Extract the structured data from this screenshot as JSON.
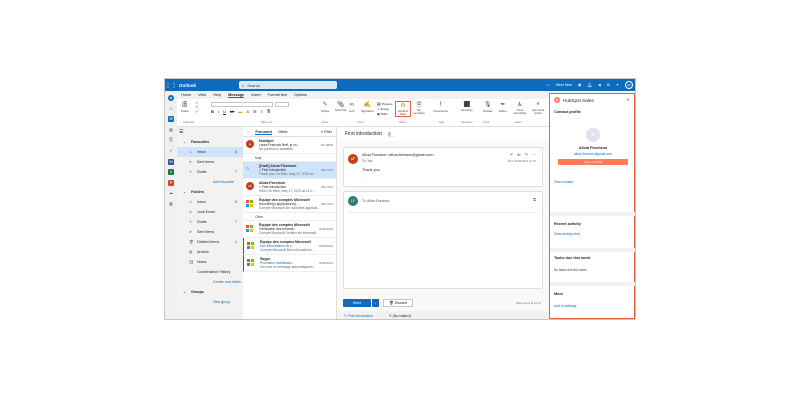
{
  "app": {
    "name": "Outlook",
    "search_placeholder": "Search",
    "meet_now": "Meet Now",
    "avatar_initials": "AF",
    "accent": "#0f6cbd",
    "hubspot_accent": "#ff7a59"
  },
  "rail_icons": [
    "user-avatar",
    "people",
    "mail",
    "calendar",
    "files",
    "to-do",
    "word",
    "excel",
    "powerpoint",
    "onedrive",
    "more-apps"
  ],
  "tabs": [
    "Home",
    "View",
    "Help",
    "Message",
    "Insert",
    "Format text",
    "Options"
  ],
  "active_tab": "Message",
  "ribbon": {
    "paste": "Paste",
    "groups": [
      "Clipboard",
      "Basic text",
      "Styles",
      "Insert",
      "Add-in",
      "Tags",
      "Sensitivity",
      "Voice",
      "Editor"
    ],
    "buttons": {
      "styles": "Styles",
      "attach": "Attach file",
      "link": "Link",
      "signature": "Signature",
      "pictures": "Pictures",
      "emoji": "Emoji",
      "table": "Table",
      "hubspot": "HubSpot Sales",
      "my_templates": "My templates",
      "importance": "Importance",
      "sensitivity": "Sensitivity",
      "dictate": "Dictate",
      "editor": "Editor",
      "check_access": "Check accessibility",
      "auto_format": "Auto format options"
    }
  },
  "folders": {
    "favorites_label": "Favourites",
    "favorites": [
      {
        "name": "Inbox",
        "count": "6",
        "selected": true
      },
      {
        "name": "Sent Items",
        "count": ""
      },
      {
        "name": "Drafts",
        "count": "7"
      }
    ],
    "add_favourite": "Add favourite",
    "folders_label": "Folders",
    "folders": [
      {
        "name": "Inbox",
        "count": "6"
      },
      {
        "name": "Junk Email",
        "count": ""
      },
      {
        "name": "Drafts",
        "count": "7"
      },
      {
        "name": "Sent Items",
        "count": ""
      },
      {
        "name": "Deleted Items",
        "count": "1"
      },
      {
        "name": "Archive",
        "count": ""
      },
      {
        "name": "Notes",
        "count": ""
      },
      {
        "name": "Conversation History",
        "count": ""
      }
    ],
    "create_new": "Create new folder",
    "groups_label": "Groups",
    "new_group": "New group"
  },
  "message_list": {
    "focused": "Focused",
    "other": "Other",
    "filter": "Filter",
    "messages": [
      {
        "avatar": "H",
        "avatar_color": "#c43e1c",
        "from": "HubSpot",
        "subject": "Laura Francois Neff, je vo...",
        "date": "Thu 08/06",
        "preview": "No preview is available."
      },
      {
        "separator": "May"
      },
      {
        "from": "[Draft] Alicia Floreison",
        "subject": "> First introduction",
        "date": "Wed 5/31",
        "preview": "Thank you On Wed, May 17, 2023 at...",
        "selected": true
      },
      {
        "avatar": "AF",
        "avatar_color": "#c43e1c",
        "from": "Alicia Floreison",
        "subject": "> First introduction",
        "date": "Wed 5/31",
        "preview": "Hello On Wed, May 17, 2023 at 11:0..."
      },
      {
        "ms": true,
        "from": "Équipe des comptes Microsoft",
        "subject": "Nouvelle(s) application(s)...",
        "date": "Wed 5/31",
        "preview": "Compte Microsoft De nouvelles applicat..."
      },
      {
        "separator": "Older"
      },
      {
        "ms": true,
        "from": "Équipe des comptes Microsoft",
        "subject": "Vérification des informa...",
        "date": "02/05/2022",
        "preview": "Compte Microsoft Vérifiez les informati..."
      },
      {
        "ms": true,
        "from": "Équipe des comptes Microsoft",
        "subject": "Des informations de s...",
        "date": "02/05/2022",
        "preview": "Compte Microsoft Des informations ...",
        "accent": true
      },
      {
        "from": "Skype",
        "subject": "Prochaine modificatio...",
        "date": "30/05/2021",
        "preview": "Ceci est un message automatiquem...",
        "accent": true,
        "ms": true
      }
    ]
  },
  "reading": {
    "subject": "First introduction",
    "sender_line": "Alicia Floreison <alicia.floreison@gmail.com>",
    "to_line": "To:  You",
    "sent_date": "Wed 31/05/2023 12:07",
    "body": "Thank you",
    "ellipsis": "...",
    "compose_initials": "LF",
    "compose_to": "To:  Alicia Floreison",
    "send": "Send",
    "discard": "Discard",
    "draft_saved": "Draft saved at 16:21",
    "bottom_tabs": [
      "First introduction",
      "(No subject)"
    ]
  },
  "hubspot": {
    "title": "HubSpot Sales",
    "contact_profile": "Contact profile",
    "contact_name": "Alicia Floreison",
    "contact_email": "alicia.floreison@gmail.com",
    "open_crm": "Open in CRM",
    "view_contact": "View contact",
    "recent_activity": "Recent activity",
    "view_activity": "View activity feed",
    "tasks_due": "Tasks due this week",
    "no_tasks": "No tasks due this week",
    "more": "More",
    "add_settings": "Add-in settings"
  }
}
